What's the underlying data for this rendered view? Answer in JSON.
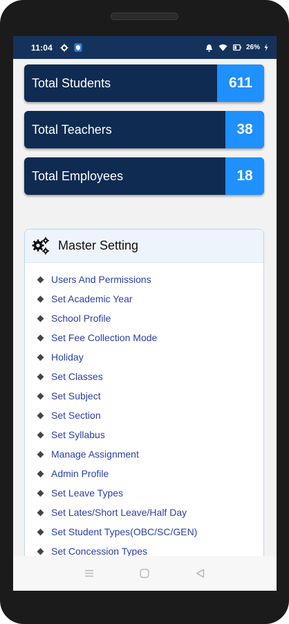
{
  "status_bar": {
    "time": "11:04",
    "battery": "26%",
    "icons": [
      "settings-icon",
      "shield-app-icon",
      "alarm-icon",
      "wifi-icon",
      "battery-icon",
      "charging-icon"
    ]
  },
  "stats": [
    {
      "label": "Total Students",
      "value": "611"
    },
    {
      "label": "Total Teachers",
      "value": "38"
    },
    {
      "label": "Total Employees",
      "value": "18"
    }
  ],
  "master_setting": {
    "title": "Master Setting",
    "icon": "gears-icon",
    "items": [
      {
        "label": "Users And Permissions"
      },
      {
        "label": "Set Academic Year"
      },
      {
        "label": "School Profile"
      },
      {
        "label": "Set Fee Collection Mode"
      },
      {
        "label": "Holiday"
      },
      {
        "label": "Set Classes"
      },
      {
        "label": "Set Subject"
      },
      {
        "label": "Set Section"
      },
      {
        "label": "Set Syllabus"
      },
      {
        "label": "Manage Assignment"
      },
      {
        "label": "Admin Profile"
      },
      {
        "label": "Set Leave Types"
      },
      {
        "label": "Set Lates/Short Leave/Half Day"
      },
      {
        "label": "Set Student Types(OBC/SC/GEN)"
      },
      {
        "label": "Set Concession Types"
      }
    ]
  },
  "nav_bar": {
    "icons": [
      "recents-icon",
      "home-icon",
      "back-icon"
    ]
  },
  "colors": {
    "status_bar": "#14335c",
    "card_bg": "#0f2b52",
    "value_bg": "#1e90ff",
    "link": "#2a3fa8"
  }
}
